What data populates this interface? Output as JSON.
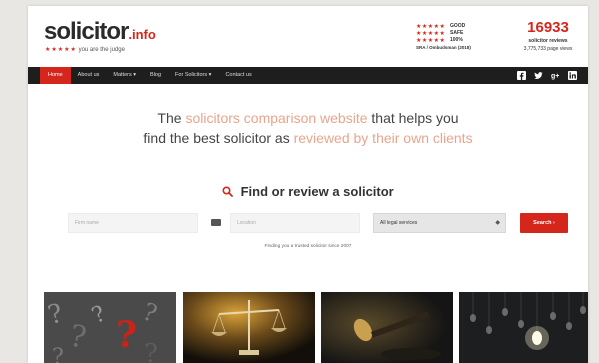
{
  "header": {
    "logo_text": "solicitor",
    "logo_tld": ".info",
    "tagline_stars": "★★★★★",
    "tagline_text": "you are the judge",
    "rating_rows": [
      {
        "stars": "★★★★★",
        "label": "GOOD"
      },
      {
        "stars": "★★★★★",
        "label": "SAFE"
      },
      {
        "stars": "★★★★★",
        "label": "100%"
      }
    ],
    "rating_caption": "SRA / Ombudsman (2018)",
    "reviews_count": "16933",
    "reviews_label": "solicitor reviews",
    "page_views": "3,775,733 page views"
  },
  "nav": {
    "items": [
      {
        "label": "Home"
      },
      {
        "label": "About us"
      },
      {
        "label": "Matters ▾"
      },
      {
        "label": "Blog"
      },
      {
        "label": "For Solicitors ▾"
      },
      {
        "label": "Contact us"
      }
    ],
    "social_icons": [
      "facebook-icon",
      "twitter-icon",
      "googleplus-icon",
      "linkedin-icon"
    ]
  },
  "hero": {
    "part1": "The ",
    "highlight1": "solicitors comparison website",
    "part2": " that helps you",
    "part3": "find the best solicitor as ",
    "highlight2": "reviewed by their own clients"
  },
  "search": {
    "heading": "Find or review a solicitor",
    "name_placeholder": "Firm name",
    "location_placeholder": "Location",
    "service_value": "All legal services",
    "button_label": "Search ›",
    "since_text": "Finding you a trusted solicitor since 2007"
  },
  "colors": {
    "brand_red": "#d5261c",
    "nav_bg": "#1e1e1e",
    "highlight": "#e8a58e"
  }
}
